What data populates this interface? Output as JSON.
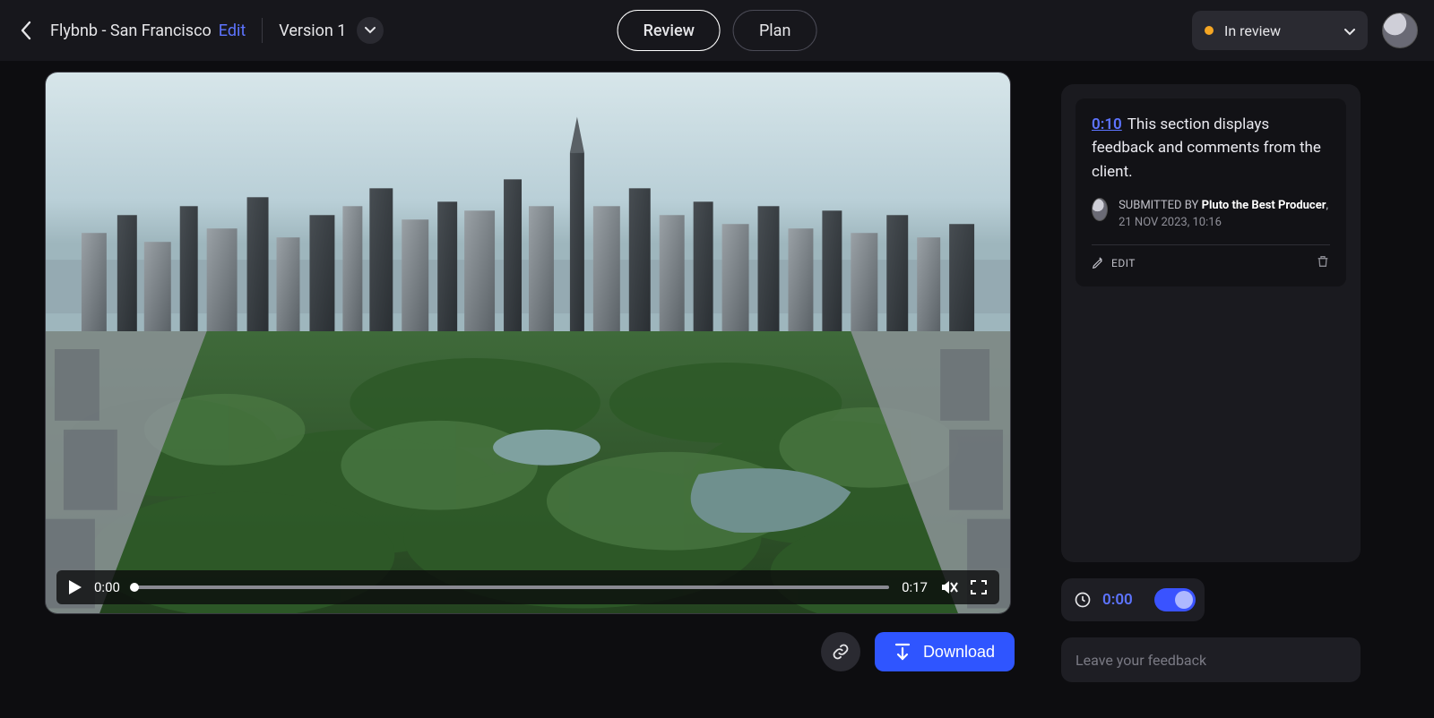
{
  "header": {
    "title": "Flybnb - San Francisco",
    "edit_label": "Edit",
    "version_label": "Version 1",
    "tabs": {
      "review": "Review",
      "plan": "Plan"
    },
    "status": {
      "label": "In review",
      "color": "#f5a623"
    }
  },
  "player": {
    "current_time": "0:00",
    "duration": "0:17"
  },
  "actions": {
    "download": "Download"
  },
  "comments": [
    {
      "timestamp": "0:10",
      "body": "This section displays feedback and comments from the client.",
      "submitted_by_label": "SUBMITTED BY",
      "author": "Pluto the Best Producer",
      "date": "21 NOV 2023, 10:16",
      "edit_label": "EDIT"
    }
  ],
  "compose": {
    "timestamp": "0:00",
    "placeholder": "Leave your feedback"
  }
}
